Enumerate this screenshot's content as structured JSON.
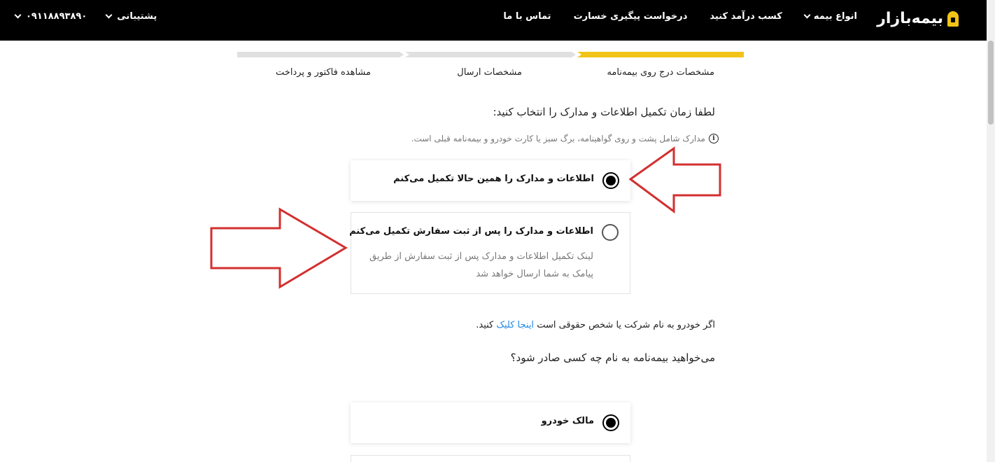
{
  "header": {
    "logo_text": "بیمه‌بازار",
    "nav": [
      {
        "label": "انواع بیمه",
        "has_dropdown": true
      },
      {
        "label": "کسب درآمد کنید",
        "has_dropdown": false
      },
      {
        "label": "درخواست پیگیری خسارت",
        "has_dropdown": false
      },
      {
        "label": "تماس با ما",
        "has_dropdown": false
      }
    ],
    "support_label": "پشتیبانی",
    "phone": "۰۹۱۱۸۸۹۳۸۹۰"
  },
  "stepper": {
    "steps": [
      "مشخصات درج روی بیمه‌نامه",
      "مشخصات ارسال",
      "مشاهده فاکتور و پرداخت"
    ],
    "active_step": 1
  },
  "completion": {
    "title": "لطفا زمان تکمیل اطلاعات و مدارک را انتخاب کنید:",
    "info": "مدارک شامل پشت و روی گواهینامه، برگ سبز یا کارت خودرو و بیمه‌نامه قبلی است.",
    "options": [
      {
        "label": "اطلاعات و مدارک را همین حالا تکمیل می‌کنم",
        "selected": true
      },
      {
        "label": "اطلاعات و مدارک را پس از ثبت سفارش تکمیل می‌کنم",
        "description": "لینک تکمیل اطلاعات و مدارک پس از ثبت سفارش از طریق پیامک به شما ارسال خواهد شد",
        "selected": false
      }
    ]
  },
  "company": {
    "before": "اگر خودرو به نام شرکت یا شخص حقوقی است ",
    "link": "اینجا کلیک",
    "after": " کنید."
  },
  "issuer": {
    "title": "می‌خواهید بیمه‌نامه به نام چه کسی صادر شود؟",
    "options": [
      {
        "label": "مالک خودرو",
        "selected": true
      }
    ]
  },
  "colors": {
    "header_bg": "#000000",
    "accent": "#f1c417",
    "link": "#1e88e5",
    "annotation_arrow": "#d32f2f"
  }
}
